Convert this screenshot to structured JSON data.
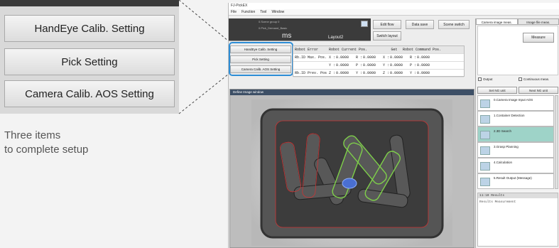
{
  "callout": {
    "buttons": [
      "HandEye Calib. Setting",
      "Pick Setting",
      "Camera Calib. AOS  Setting"
    ],
    "caption_line1": "Three items",
    "caption_line2": "to complete setup"
  },
  "window": {
    "title": "FJ-PickEX",
    "menu": [
      "File",
      "Function",
      "Tool",
      "Window"
    ],
    "header": {
      "scene_group": "0.Scene group 0",
      "scene": "0.Pick_Demand_Basic",
      "brand": "ms",
      "layout": "Layout2"
    },
    "top_buttons": [
      "Edit flow",
      "Data save",
      "Scene switch",
      "Switch layout"
    ],
    "left_buttons": [
      "HandEye Calib. Setting",
      "Pick Setting",
      "Camera Calib. AOS  Setting"
    ],
    "table": {
      "header": [
        "Robot  Error",
        "Robot  Current  Pos.",
        "",
        "Get",
        "Robot  Command  Pos.",
        ""
      ],
      "rows": [
        [
          "Rb.ID  Max.  Pos.",
          "X :",
          "0.0000",
          "R :",
          "0.0000",
          "X :",
          "0.0000",
          "R :",
          "0.0000"
        ],
        [
          "",
          "Y :",
          "0.0000",
          "P :",
          "0.0000",
          "Y :",
          "0.0000",
          "P :",
          "0.0000"
        ],
        [
          "Rb.ID  Prev.  Pos.",
          "Z :",
          "0.0000",
          "Y :",
          "0.0000",
          "Z :",
          "0.0000",
          "Y :",
          "0.0000"
        ]
      ]
    },
    "image_panel_title": "Define Image window",
    "right_panel": {
      "tabs": [
        "Camera image meas.",
        "Image file meas."
      ],
      "measure_label": "Measure",
      "output_label": "Output",
      "continuous_label": "Continuous meas.",
      "flow_tabs": [
        "Set NG unit",
        "Next NG unit"
      ],
      "flow_items": [
        "0.Camera Image Input AOS",
        "1.Container Detection",
        "2.3D Search",
        "3.Grasp Planning",
        "4.Calculation",
        "5.Result Output (Message)"
      ],
      "console_header": "11:10 Results",
      "console_text": "Results     Measurement"
    },
    "colors": {
      "highlight": "#2d8dd6",
      "selected_flow": "#9ed3c8",
      "header": "#3b3b3b"
    }
  }
}
